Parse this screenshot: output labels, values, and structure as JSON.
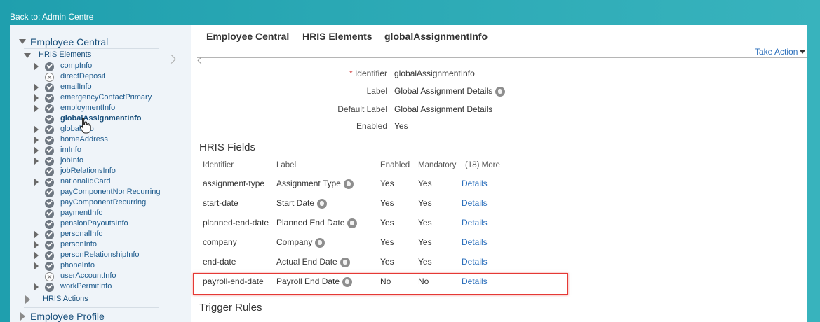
{
  "topbar": {
    "back_link": "Back to: Admin Centre"
  },
  "sidebar": {
    "root_label": "Employee Central",
    "hris_elements_label": "HRIS Elements",
    "elements": [
      {
        "label": "compInfo",
        "status": "ok",
        "expandable": true,
        "selected": false,
        "underlined": false
      },
      {
        "label": "directDeposit",
        "status": "x",
        "expandable": false,
        "selected": false,
        "underlined": false
      },
      {
        "label": "emailInfo",
        "status": "ok",
        "expandable": true,
        "selected": false,
        "underlined": false
      },
      {
        "label": "emergencyContactPrimary",
        "status": "ok",
        "expandable": true,
        "selected": false,
        "underlined": false
      },
      {
        "label": "employmentInfo",
        "status": "ok",
        "expandable": true,
        "selected": false,
        "underlined": false
      },
      {
        "label": "globalAssignmentInfo",
        "status": "ok",
        "expandable": false,
        "selected": true,
        "underlined": false
      },
      {
        "label": "globalInfo",
        "status": "ok",
        "expandable": true,
        "selected": false,
        "underlined": false
      },
      {
        "label": "homeAddress",
        "status": "ok",
        "expandable": true,
        "selected": false,
        "underlined": false
      },
      {
        "label": "imInfo",
        "status": "ok",
        "expandable": true,
        "selected": false,
        "underlined": false
      },
      {
        "label": "jobInfo",
        "status": "ok",
        "expandable": true,
        "selected": false,
        "underlined": false
      },
      {
        "label": "jobRelationsInfo",
        "status": "ok",
        "expandable": false,
        "selected": false,
        "underlined": false
      },
      {
        "label": "nationalIdCard",
        "status": "ok",
        "expandable": true,
        "selected": false,
        "underlined": false
      },
      {
        "label": "payComponentNonRecurring",
        "status": "ok",
        "expandable": false,
        "selected": false,
        "underlined": true
      },
      {
        "label": "payComponentRecurring",
        "status": "ok",
        "expandable": false,
        "selected": false,
        "underlined": false
      },
      {
        "label": "paymentInfo",
        "status": "ok",
        "expandable": false,
        "selected": false,
        "underlined": false
      },
      {
        "label": "pensionPayoutsInfo",
        "status": "ok",
        "expandable": false,
        "selected": false,
        "underlined": false
      },
      {
        "label": "personalInfo",
        "status": "ok",
        "expandable": true,
        "selected": false,
        "underlined": false
      },
      {
        "label": "personInfo",
        "status": "ok",
        "expandable": true,
        "selected": false,
        "underlined": false
      },
      {
        "label": "personRelationshipInfo",
        "status": "ok",
        "expandable": true,
        "selected": false,
        "underlined": false
      },
      {
        "label": "phoneInfo",
        "status": "ok",
        "expandable": true,
        "selected": false,
        "underlined": false
      },
      {
        "label": "userAccountInfo",
        "status": "x",
        "expandable": false,
        "selected": false,
        "underlined": false
      },
      {
        "label": "workPermitInfo",
        "status": "ok",
        "expandable": true,
        "selected": false,
        "underlined": false
      }
    ],
    "hris_actions_label": "HRIS Actions",
    "employee_profile_label": "Employee Profile"
  },
  "main": {
    "breadcrumb": [
      "Employee Central",
      "HRIS Elements",
      "globalAssignmentInfo"
    ],
    "take_action": "Take Action",
    "properties": {
      "identifier_label": "Identifier",
      "identifier_required": "*",
      "identifier_value": "globalAssignmentInfo",
      "label_label": "Label",
      "label_value": "Global Assignment Details",
      "default_label_label": "Default Label",
      "default_label_value": "Global Assignment Details",
      "enabled_label": "Enabled",
      "enabled_value": "Yes"
    },
    "hris_fields_title": "HRIS Fields",
    "table": {
      "headers": {
        "identifier": "Identifier",
        "label": "Label",
        "enabled": "Enabled",
        "mandatory": "Mandatory",
        "more": "(18) More"
      },
      "rows": [
        {
          "identifier": "assignment-type",
          "label": "Assignment Type",
          "enabled": "Yes",
          "mandatory": "Yes",
          "action": "Details"
        },
        {
          "identifier": "start-date",
          "label": "Start Date",
          "enabled": "Yes",
          "mandatory": "Yes",
          "action": "Details"
        },
        {
          "identifier": "planned-end-date",
          "label": "Planned End Date",
          "enabled": "Yes",
          "mandatory": "Yes",
          "action": "Details"
        },
        {
          "identifier": "company",
          "label": "Company",
          "enabled": "Yes",
          "mandatory": "Yes",
          "action": "Details"
        },
        {
          "identifier": "end-date",
          "label": "Actual End Date",
          "enabled": "Yes",
          "mandatory": "Yes",
          "action": "Details"
        },
        {
          "identifier": "payroll-end-date",
          "label": "Payroll End Date",
          "enabled": "No",
          "mandatory": "No",
          "action": "Details"
        }
      ]
    },
    "trigger_rules_title": "Trigger Rules",
    "colors": {
      "accent": "#2a6ebb",
      "highlight": "#e53935"
    }
  }
}
